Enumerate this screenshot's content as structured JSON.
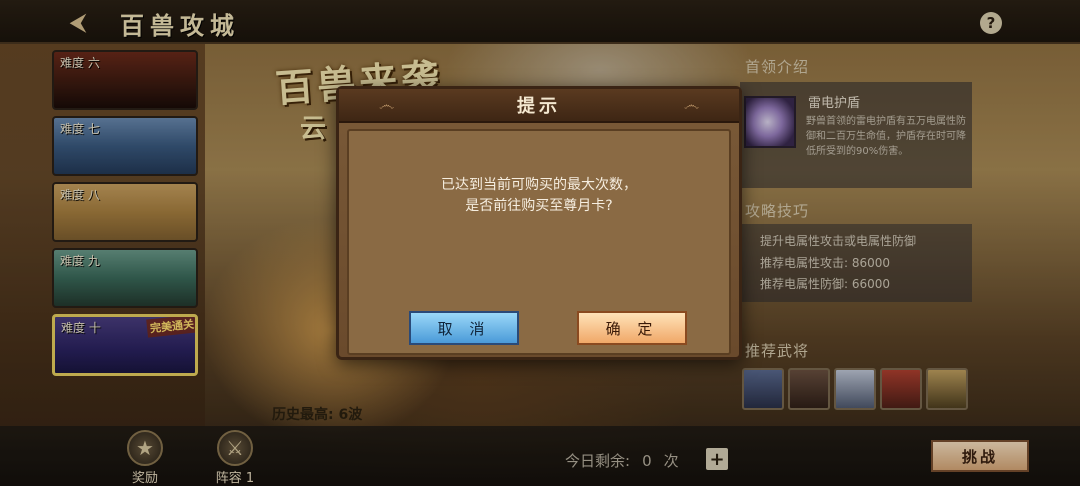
{
  "header": {
    "back_icon": "back-arrow-icon",
    "title": "百兽攻城",
    "help_label": "?"
  },
  "banner": {
    "title": "百兽来袭",
    "subtitle": "云"
  },
  "levels": [
    {
      "label": "难度 六"
    },
    {
      "label": "难度 七"
    },
    {
      "label": "难度 八"
    },
    {
      "label": "难度 九"
    },
    {
      "label": "难度 十",
      "badge": "完美通关",
      "selected": true
    }
  ],
  "history": {
    "best_label": "历史最高: 6波"
  },
  "right_panel": {
    "boss_section_title": "首领介绍",
    "boss_name": "雷电护盾",
    "boss_desc": "野兽首领的雷电护盾有五万电属性防御和二百万生命值，护盾存在时可降低所受到的90%伤害。",
    "strategy_title": "攻略技巧",
    "tips": [
      "提升电属性攻击或电属性防御",
      "推荐电属性攻击: 86000",
      "推荐电属性防御: 66000"
    ],
    "heroes_title": "推荐武将",
    "heroes": [
      "hero-1",
      "hero-2",
      "hero-3",
      "hero-4",
      "hero-5"
    ]
  },
  "bottom": {
    "reward_label": "奖励",
    "lineup_label": "阵容 1",
    "remain_prefix": "今日剩余:",
    "remain_count": "0",
    "remain_suffix": "次",
    "plus_label": "+",
    "challenge_label": "挑战"
  },
  "dialog": {
    "title": "提示",
    "message_line1": "已达到当前可购买的最大次数，",
    "message_line2": "是否前往购买至尊月卡?",
    "cancel_label": "取 消",
    "confirm_label": "确 定"
  }
}
